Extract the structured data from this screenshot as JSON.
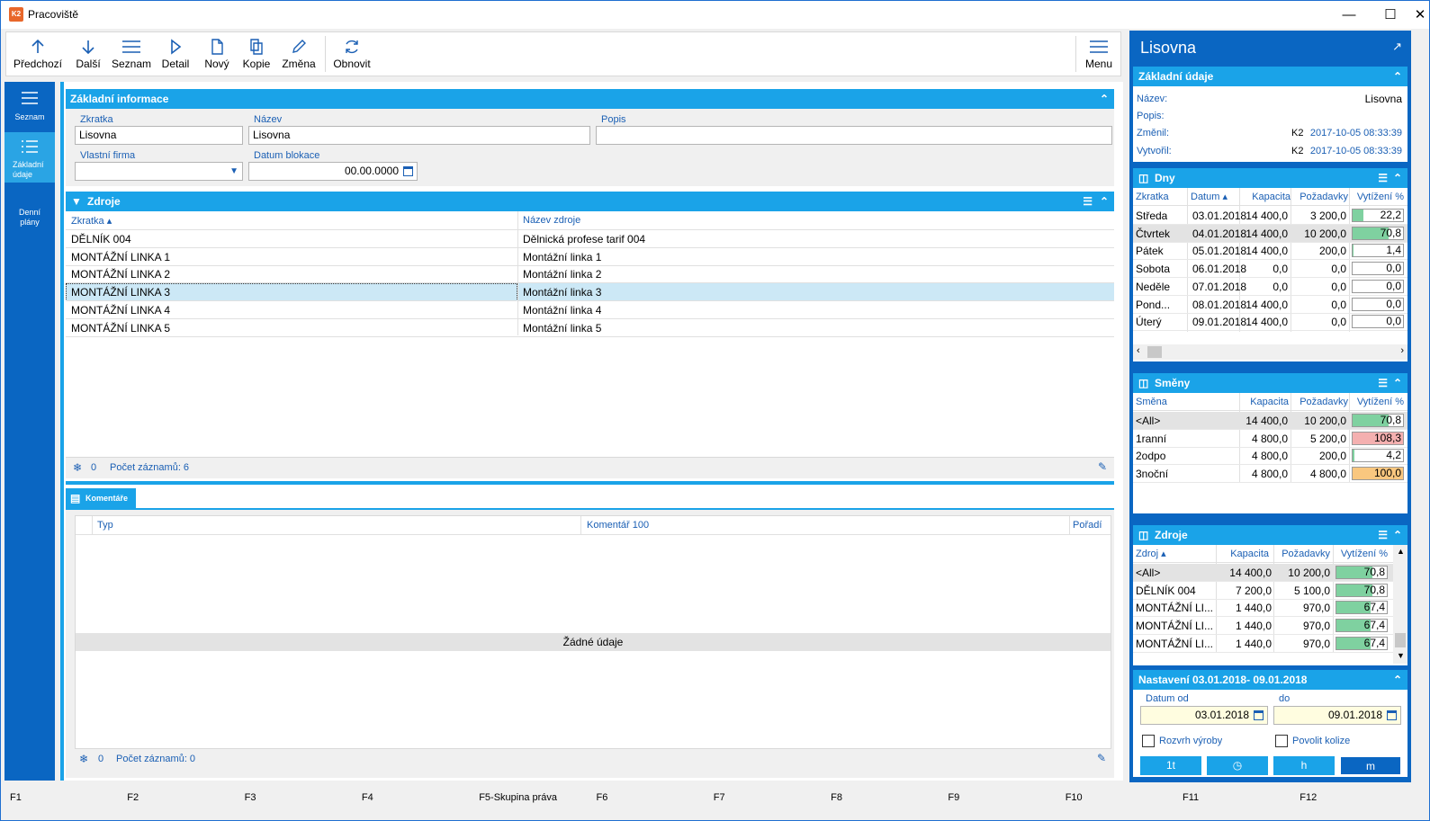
{
  "window": {
    "title": "Pracoviště",
    "app_icon": "K2"
  },
  "toolbar": {
    "items": [
      {
        "label": "Předchozí",
        "icon": "arrow-up-icon"
      },
      {
        "label": "Další",
        "icon": "arrow-down-icon"
      },
      {
        "label": "Seznam",
        "icon": "list-icon"
      },
      {
        "label": "Detail",
        "icon": "play-icon"
      },
      {
        "label": "Nový",
        "icon": "new-document-icon"
      },
      {
        "label": "Kopie",
        "icon": "copy-icon"
      },
      {
        "label": "Změna",
        "icon": "pencil-icon"
      },
      {
        "label": "Obnovit",
        "icon": "refresh-icon"
      }
    ],
    "menu_label": "Menu"
  },
  "leftnav": {
    "items": [
      {
        "label": "Seznam"
      },
      {
        "label": "Základní údaje"
      },
      {
        "label": "Denní plány"
      }
    ]
  },
  "basic": {
    "header": "Základní informace",
    "zkratka_label": "Zkratka",
    "zkratka_value": "Lisovna",
    "nazev_label": "Název",
    "nazev_value": "Lisovna",
    "popis_label": "Popis",
    "popis_value": "",
    "firma_label": "Vlastní firma",
    "firma_value": "",
    "blokace_label": "Datum blokace",
    "blokace_value": "00.00.0000"
  },
  "zdroje": {
    "header": "Zdroje",
    "col1": "Zkratka",
    "col2": "Název zdroje",
    "rows": [
      [
        "DĚLNÍK 004",
        "Dělnická profese tarif 004"
      ],
      [
        "MONTÁŽNÍ LINKA 1",
        "Montážní linka 1"
      ],
      [
        "MONTÁŽNÍ LINKA 2",
        "Montážní linka 2"
      ],
      [
        "MONTÁŽNÍ LINKA 3",
        "Montážní linka 3"
      ],
      [
        "MONTÁŽNÍ LINKA 4",
        "Montážní linka 4"
      ],
      [
        "MONTÁŽNÍ LINKA 5",
        "Montážní linka 5"
      ]
    ],
    "footer_count": "0",
    "footer_label": "Počet záznamů: 6"
  },
  "komentare": {
    "tab": "Komentáře",
    "col1": "Typ",
    "col2": "Komentář 100",
    "col3": "Pořadí",
    "empty": "Žádné údaje",
    "footer_count": "0",
    "footer_label": "Počet záznamů: 0"
  },
  "right": {
    "title": "Lisovna",
    "zakladni": {
      "header": "Základní údaje",
      "nazev_label": "Název:",
      "nazev_value": "Lisovna",
      "popis_label": "Popis:",
      "zmenil_label": "Změnil:",
      "zmenil_user": "K2",
      "zmenil_date": "2017-10-05 08:33:39",
      "vytvoril_label": "Vytvořil:",
      "vytvoril_user": "K2",
      "vytvoril_date": "2017-10-05 08:33:39"
    },
    "dny": {
      "header": "Dny",
      "cols": [
        "Zkratka",
        "Datum",
        "Kapacita",
        "Požadavky",
        "Vytížení %"
      ],
      "rows": [
        {
          "d": "Středa",
          "date": "03.01.2018",
          "kap": "14 400,0",
          "poz": "3 200,0",
          "vyt": "22,2",
          "pct": 22.2
        },
        {
          "d": "Čtvrtek",
          "date": "04.01.2018",
          "kap": "14 400,0",
          "poz": "10 200,0",
          "vyt": "70,8",
          "pct": 70.8
        },
        {
          "d": "Pátek",
          "date": "05.01.2018",
          "kap": "14 400,0",
          "poz": "200,0",
          "vyt": "1,4",
          "pct": 1.4
        },
        {
          "d": "Sobota",
          "date": "06.01.2018",
          "kap": "0,0",
          "poz": "0,0",
          "vyt": "0,0",
          "pct": 0
        },
        {
          "d": "Neděle",
          "date": "07.01.2018",
          "kap": "0,0",
          "poz": "0,0",
          "vyt": "0,0",
          "pct": 0
        },
        {
          "d": "Pond...",
          "date": "08.01.2018",
          "kap": "14 400,0",
          "poz": "0,0",
          "vyt": "0,0",
          "pct": 0
        },
        {
          "d": "Úterý",
          "date": "09.01.2018",
          "kap": "14 400,0",
          "poz": "0,0",
          "vyt": "0,0",
          "pct": 0
        }
      ]
    },
    "smeny": {
      "header": "Směny",
      "cols": [
        "Směna",
        "Kapacita",
        "Požadavky",
        "Vytížení %"
      ],
      "rows": [
        {
          "s": "<All>",
          "kap": "14 400,0",
          "poz": "10 200,0",
          "vyt": "70,8",
          "pct": 70.8,
          "color": "#7fd1a0"
        },
        {
          "s": "1ranní",
          "kap": "4 800,0",
          "poz": "5 200,0",
          "vyt": "108,3",
          "pct": 100,
          "color": "#f4b0b0"
        },
        {
          "s": "2odpo",
          "kap": "4 800,0",
          "poz": "200,0",
          "vyt": "4,2",
          "pct": 4.2,
          "color": "#7fd1a0"
        },
        {
          "s": "3noční",
          "kap": "4 800,0",
          "poz": "4 800,0",
          "vyt": "100,0",
          "pct": 100,
          "color": "#f9c77f"
        }
      ]
    },
    "zdroje": {
      "header": "Zdroje",
      "cols": [
        "Zdroj",
        "Kapacita",
        "Požadavky",
        "Vytížení %"
      ],
      "rows": [
        {
          "z": "<All>",
          "kap": "14 400,0",
          "poz": "10 200,0",
          "vyt": "70,8",
          "pct": 70.8
        },
        {
          "z": "DĚLNÍK 004",
          "kap": "7 200,0",
          "poz": "5 100,0",
          "vyt": "70,8",
          "pct": 70.8
        },
        {
          "z": "MONTÁŽNÍ LI...",
          "kap": "1 440,0",
          "poz": "970,0",
          "vyt": "67,4",
          "pct": 67.4
        },
        {
          "z": "MONTÁŽNÍ LI...",
          "kap": "1 440,0",
          "poz": "970,0",
          "vyt": "67,4",
          "pct": 67.4
        },
        {
          "z": "MONTÁŽNÍ LI...",
          "kap": "1 440,0",
          "poz": "970,0",
          "vyt": "67,4",
          "pct": 67.4
        }
      ]
    },
    "nastaveni": {
      "header": "Nastavení 03.01.2018- 09.01.2018",
      "od_label": "Datum od",
      "od_value": "03.01.2018",
      "do_label": "do",
      "do_value": "09.01.2018",
      "rozvrh": "Rozvrh výroby",
      "kolize": "Povolit kolize",
      "buttons": [
        "1t",
        "",
        "h",
        "m"
      ]
    }
  },
  "fkeys": [
    "F1",
    "F2",
    "F3",
    "F4",
    "F5-Skupina práva",
    "F6",
    "F7",
    "F8",
    "F9",
    "F10",
    "F11",
    "F12"
  ],
  "colors": {
    "accent": "#1aa3e8",
    "nav": "#0a66c2",
    "green": "#7fd1a0",
    "selected": "#cce8f6"
  }
}
